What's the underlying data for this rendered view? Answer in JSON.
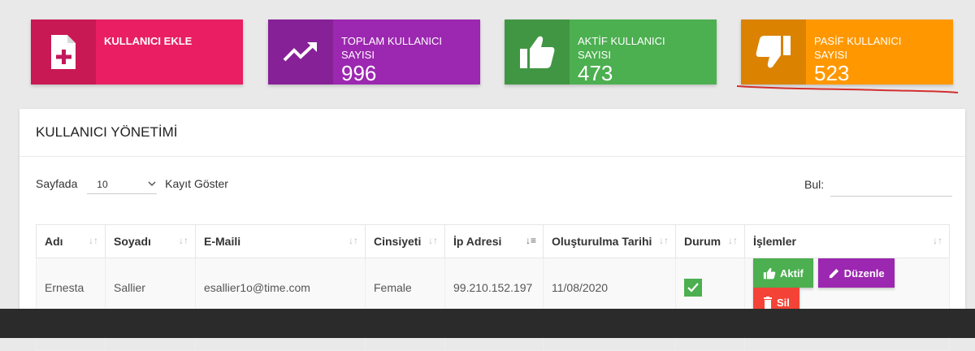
{
  "cards": {
    "add_user": {
      "title": "KULLANICI EKLE",
      "color": "#e91e63"
    },
    "total_users": {
      "title": "TOPLAM KULLANICI SAYISI",
      "value": "996",
      "color": "#9c27b0"
    },
    "active_users": {
      "title": "AKTİF KULLANICI SAYISI",
      "value": "473",
      "color": "#4caf50"
    },
    "passive_users": {
      "title": "PASİF KULLANICI SAYISI",
      "value": "523",
      "color": "#ff9800"
    }
  },
  "panel": {
    "title": "KULLANICI YÖNETİMİ",
    "page_prefix": "Sayfada",
    "page_size": "10",
    "page_suffix": "Kayıt Göster",
    "search_label": "Bul:",
    "search_value": ""
  },
  "table": {
    "headers": [
      "Adı",
      "Soyadı",
      "E-Maili",
      "Cinsiyeti",
      "İp Adresi",
      "Oluşturulma Tarihi",
      "Durum",
      "İşlemler"
    ],
    "rows": [
      {
        "first_name": "Ernesta",
        "last_name": "Sallier",
        "email": "esallier1o@time.com",
        "gender": "Female",
        "ip": "99.210.152.197",
        "created": "11/08/2020",
        "status_checked": true
      }
    ],
    "actions": {
      "activate": "Aktif",
      "edit": "Düzenle",
      "delete": "Sil"
    }
  },
  "colors": {
    "accent_underline": "#d32f2f",
    "check": "#4caf50",
    "edit": "#9c27b0",
    "delete": "#f44336"
  }
}
